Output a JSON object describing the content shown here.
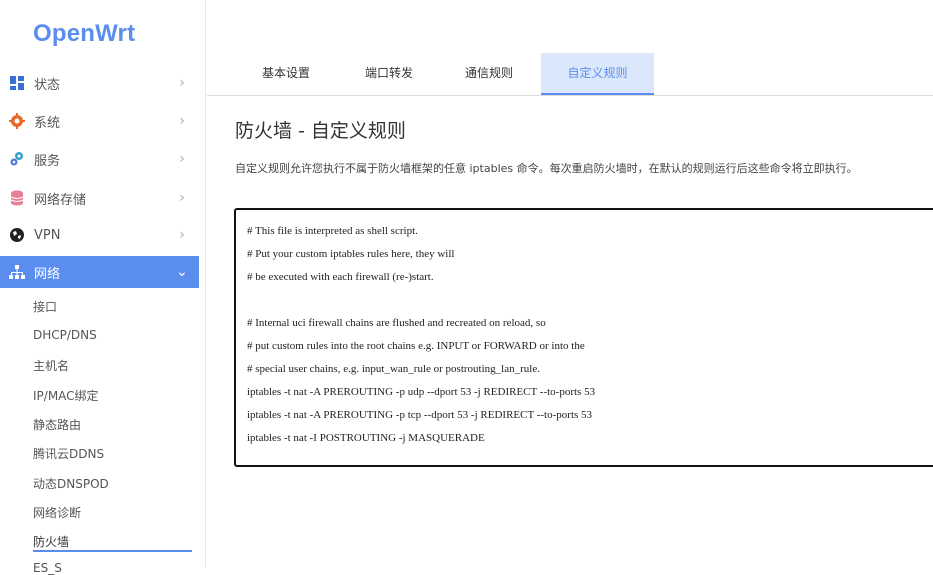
{
  "app": {
    "logo": "OpenWrt"
  },
  "sidebar": {
    "items": [
      {
        "label": "状态",
        "icon": "dashboard-icon"
      },
      {
        "label": "系统",
        "icon": "gear-icon"
      },
      {
        "label": "服务",
        "icon": "services-icon"
      },
      {
        "label": "网络存储",
        "icon": "database-icon"
      },
      {
        "label": "VPN",
        "icon": "vpn-icon"
      },
      {
        "label": "网络",
        "icon": "network-icon",
        "active": true
      }
    ],
    "subitems": [
      {
        "label": "接口"
      },
      {
        "label": "DHCP/DNS"
      },
      {
        "label": "主机名"
      },
      {
        "label": "IP/MAC绑定"
      },
      {
        "label": "静态路由"
      },
      {
        "label": "腾讯云DDNS"
      },
      {
        "label": "动态DNSPOD"
      },
      {
        "label": "网络诊断"
      },
      {
        "label": "防火墙",
        "active": true
      },
      {
        "label": "ES_S"
      }
    ]
  },
  "tabs": [
    {
      "label": "基本设置"
    },
    {
      "label": "端口转发"
    },
    {
      "label": "通信规则"
    },
    {
      "label": "自定义规则",
      "active": true
    }
  ],
  "main": {
    "title": "防火墙 - 自定义规则",
    "description": "自定义规则允许您执行不属于防火墙框架的任意 iptables 命令。每次重启防火墙时，在默认的规则运行后这些命令将立即执行。",
    "code_lines": [
      "# This file is interpreted as shell script.",
      "# Put your custom iptables rules here, they will",
      "# be executed with each firewall (re-)start.",
      "",
      "# Internal uci firewall chains are flushed and recreated on reload, so",
      "# put custom rules into the root chains e.g. INPUT or FORWARD or into the",
      "# special user chains, e.g. input_wan_rule or postrouting_lan_rule.",
      "iptables -t nat -A PREROUTING -p udp --dport 53 -j REDIRECT --to-ports 53",
      "iptables -t nat -A PREROUTING -p tcp --dport 53 -j REDIRECT --to-ports 53",
      "iptables -t nat -I POSTROUTING -j MASQUERADE"
    ]
  },
  "colors": {
    "accent": "#5b8def",
    "tab_active_bg": "#dbe8fb"
  }
}
